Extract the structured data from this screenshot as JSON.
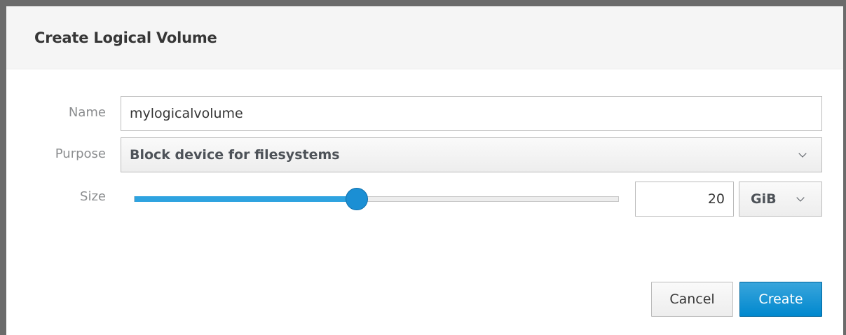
{
  "dialog": {
    "title": "Create Logical Volume"
  },
  "form": {
    "name": {
      "label": "Name",
      "value": "mylogicalvolume"
    },
    "purpose": {
      "label": "Purpose",
      "selected": "Block device for filesystems"
    },
    "size": {
      "label": "Size",
      "slider_fraction": 0.46,
      "value": "20",
      "unit": "GiB"
    }
  },
  "buttons": {
    "cancel": "Cancel",
    "create": "Create"
  },
  "colors": {
    "accent": "#0088ce",
    "slider_fill": "#2ea3e0"
  }
}
